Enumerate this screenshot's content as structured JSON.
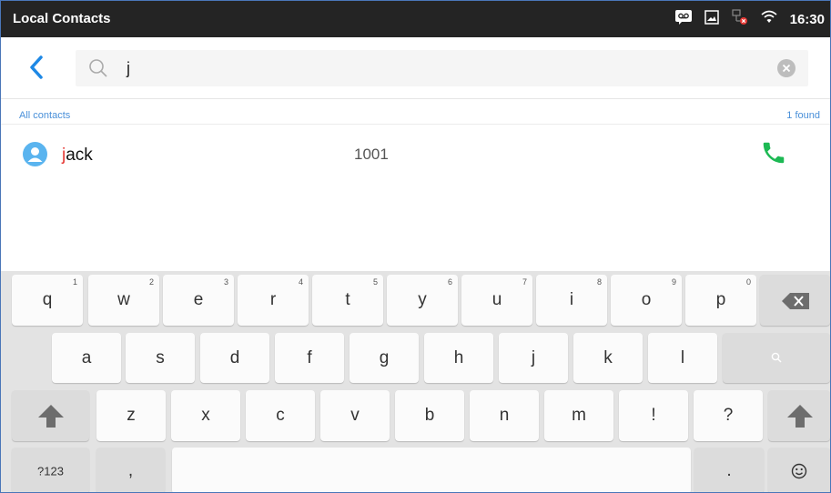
{
  "status_bar": {
    "title": "Local Contacts",
    "time": "16:30",
    "icons": [
      "voicemail-icon",
      "screenshot-icon",
      "network-error-icon",
      "wifi-icon"
    ]
  },
  "search": {
    "query": "j",
    "back_icon": "chevron-left-icon",
    "search_icon": "search-icon",
    "clear_icon": "clear-icon"
  },
  "list": {
    "section_label": "All contacts",
    "found_count": "1 found",
    "contacts": [
      {
        "name_match": "j",
        "name_rest": "ack",
        "number": "1001"
      }
    ]
  },
  "keyboard": {
    "row1": [
      {
        "label": "q",
        "hint": "1"
      },
      {
        "label": "w",
        "hint": "2"
      },
      {
        "label": "e",
        "hint": "3"
      },
      {
        "label": "r",
        "hint": "4"
      },
      {
        "label": "t",
        "hint": "5"
      },
      {
        "label": "y",
        "hint": "6"
      },
      {
        "label": "u",
        "hint": "7"
      },
      {
        "label": "i",
        "hint": "8"
      },
      {
        "label": "o",
        "hint": "9"
      },
      {
        "label": "p",
        "hint": "0"
      }
    ],
    "row2": [
      "a",
      "s",
      "d",
      "f",
      "g",
      "h",
      "j",
      "k",
      "l"
    ],
    "row3": [
      "z",
      "x",
      "c",
      "v",
      "b",
      "n",
      "m",
      "!",
      "?"
    ],
    "mode_switch": "?123",
    "comma": ",",
    "period": "."
  },
  "colors": {
    "accent": "#1e88e5",
    "highlight": "#e53935",
    "call_green": "#1db954",
    "status_bg": "#242424"
  }
}
